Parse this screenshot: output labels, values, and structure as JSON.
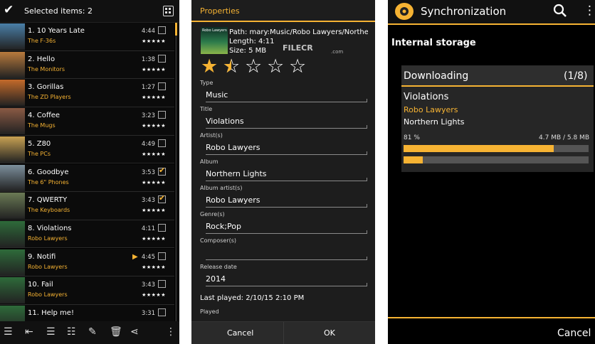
{
  "panel1": {
    "header": {
      "title": "Selected items: 2"
    },
    "rows": [
      {
        "title": "1. 10 Years Late",
        "artist": "The F-36s",
        "duration": "4:44",
        "stars": "★★★★★",
        "checked": false,
        "thumb": "#4a7fa8"
      },
      {
        "title": "2. Hello",
        "artist": "The Monitors",
        "duration": "1:38",
        "stars": "★★★★★",
        "checked": false,
        "thumb": "#b87a3d"
      },
      {
        "title": "3. Gorillas",
        "artist": "The ZD Players",
        "duration": "1:27",
        "stars": "★★★★★",
        "checked": false,
        "thumb": "#c46a2a"
      },
      {
        "title": "4. Coffee",
        "artist": "The Mugs",
        "duration": "3:23",
        "stars": "★★★★★",
        "checked": false,
        "thumb": "#8a5a44"
      },
      {
        "title": "5. Z80",
        "artist": "The PCs",
        "duration": "4:49",
        "stars": "★★★★★",
        "checked": false,
        "thumb": "#c9a253"
      },
      {
        "title": "6. Goodbye",
        "artist": "The 6\" Phones",
        "duration": "3:53",
        "stars": "★★★★★",
        "checked": true,
        "thumb": "#7c8f9c"
      },
      {
        "title": "7. QWERTY",
        "artist": "The Keyboards",
        "duration": "3:43",
        "stars": "★★★★★",
        "checked": true,
        "thumb": "#6b7a55"
      },
      {
        "title": "8. Violations",
        "artist": "Robo Lawyers",
        "duration": "4:11",
        "stars": "★★★★★",
        "checked": false,
        "thumb": "#2e6b3a"
      },
      {
        "title": "9. Notifi",
        "artist": "Robo Lawyers",
        "duration": "4:45",
        "stars": "★★★★★",
        "checked": false,
        "thumb": "#2e6b3a",
        "playing": "▶"
      },
      {
        "title": "10. Fail",
        "artist": "Robo Lawyers",
        "duration": "3:43",
        "stars": "★★★★★",
        "checked": false,
        "thumb": "#2e6b3a"
      },
      {
        "title": "11. Help me!",
        "artist": "",
        "duration": "3:31",
        "stars": "",
        "checked": false,
        "thumb": "#2e6b3a"
      }
    ],
    "toolbar_icons": [
      "queue-next-icon",
      "queue-last-icon",
      "queue-add-icon",
      "list-icon",
      "edit-icon",
      "delete-icon",
      "share-icon",
      "more-vert-icon"
    ]
  },
  "panel2": {
    "header": {
      "title": "Properties"
    },
    "info": {
      "path": "Path:  mary:Music/Robo Lawyers/Northern",
      "length": "Length: 4:11",
      "size": "Size: 5 MB",
      "thumb_text": "Robo Lawyers"
    },
    "rating": 1.5,
    "watermark": {
      "main": "FILECR",
      "sub": ".com"
    },
    "fields": [
      {
        "label": "Type",
        "value": "Music"
      },
      {
        "label": "Title",
        "value": "Violations"
      },
      {
        "label": "Artist(s)",
        "value": "Robo Lawyers"
      },
      {
        "label": "Album",
        "value": "Northern Lights"
      },
      {
        "label": "Album artist(s)",
        "value": "Robo Lawyers"
      },
      {
        "label": "Genre(s)",
        "value": "Rock;Pop"
      },
      {
        "label": "Composer(s)",
        "value": ""
      },
      {
        "label": "Release date",
        "value": "2014"
      }
    ],
    "last_played": "Last played: 2/10/15 2:10 PM",
    "played_label": "Played",
    "buttons": {
      "cancel": "Cancel",
      "ok": "OK"
    }
  },
  "panel3": {
    "header": {
      "title": "Synchronization"
    },
    "section": "Internal storage",
    "card": {
      "status": "Downloading",
      "count": "(1/8)",
      "track": "Violations",
      "artist": "Robo Lawyers",
      "album": "Northern Lights",
      "percent": "81 %",
      "progress": 0.81,
      "size": "4.7 MB / 5.8 MB",
      "overall_progress": 0.105
    },
    "cancel": "Cancel"
  },
  "colors": {
    "accent": "#f6b333",
    "background": "#000000"
  }
}
